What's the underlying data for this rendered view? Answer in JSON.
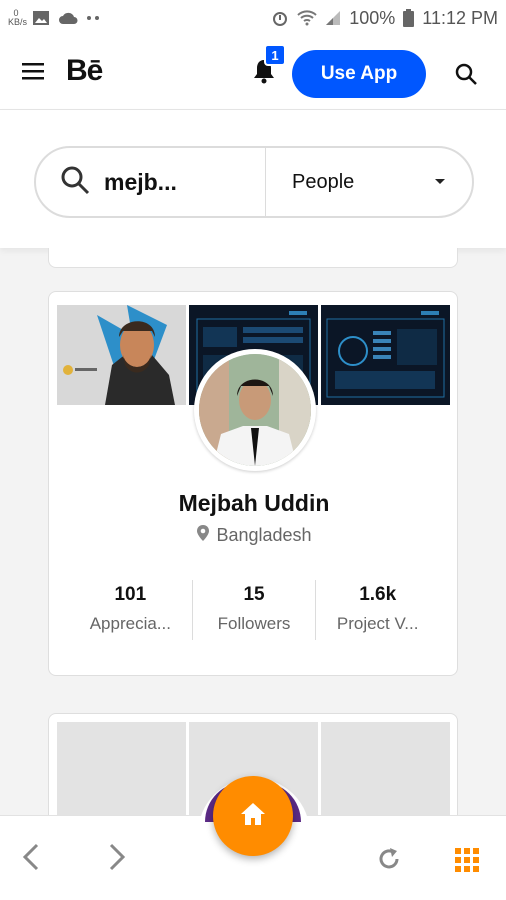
{
  "status_bar": {
    "kbs_top": "0",
    "kbs_bottom": "KB/s",
    "battery": "100%",
    "time": "11:12 PM"
  },
  "app_bar": {
    "brand": "Bē",
    "notification_count": "1",
    "use_app_label": "Use App"
  },
  "search": {
    "query": "mejb...",
    "type_filter": "People"
  },
  "profile_card": {
    "name": "Mejbah Uddin",
    "location": "Bangladesh",
    "stats": [
      {
        "value": "101",
        "label": "Apprecia..."
      },
      {
        "value": "15",
        "label": "Followers"
      },
      {
        "value": "1.6k",
        "label": "Project V..."
      }
    ]
  },
  "colors": {
    "primary": "#0057ff",
    "home_button": "#ff8c00",
    "grid_icon": "#ff8c00"
  }
}
